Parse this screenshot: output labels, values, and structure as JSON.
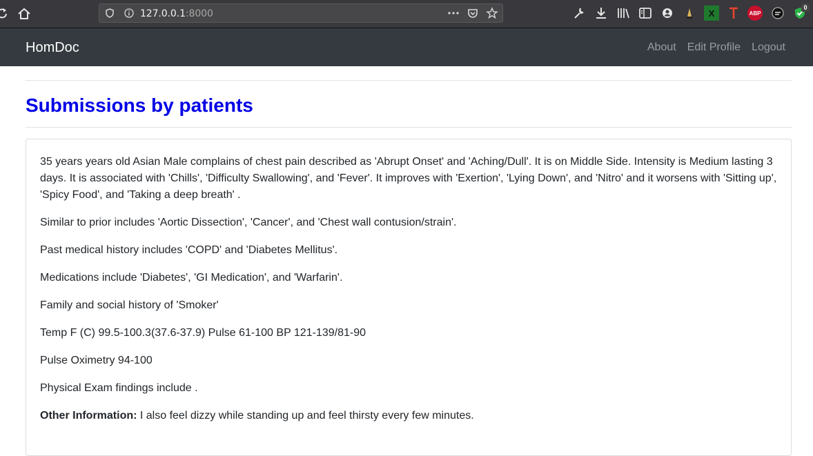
{
  "browser": {
    "url_host": "127.0.0.1",
    "url_port": ":8000"
  },
  "navbar": {
    "brand": "HomDoc",
    "links": [
      "About",
      "Edit Profile",
      "Logout"
    ]
  },
  "page": {
    "title": "Submissions by patients"
  },
  "submission": {
    "summary": "35 years years old Asian Male complains of chest pain described as 'Abrupt Onset' and 'Aching/Dull'. It is on Middle Side. Intensity is Medium lasting 3 days. It is associated with 'Chills', 'Difficulty Swallowing', and 'Fever'. It improves with 'Exertion', 'Lying Down', and 'Nitro' and it worsens with 'Sitting up', 'Spicy Food', and 'Taking a deep breath' .",
    "similar_prior": "Similar to prior includes 'Aortic Dissection', 'Cancer', and 'Chest wall contusion/strain'.",
    "past_history": "Past medical history includes 'COPD' and 'Diabetes Mellitus'.",
    "medications": "Medications include 'Diabetes', 'GI Medication', and 'Warfarin'.",
    "family_social": "Family and social history of 'Smoker'",
    "vitals": "Temp F (C) 99.5-100.3(37.6-37.9) Pulse 61-100 BP 121-139/81-90",
    "oximetry": "Pulse Oximetry 94-100",
    "exam": "Physical Exam findings include .",
    "other_label": "Other Information:",
    "other_text": " I also feel dizzy while standing up and feel thirsty every few minutes."
  },
  "extensions": {
    "notification_count": "0",
    "abp_label": "ABP"
  },
  "icons": [
    "reload-icon",
    "home-icon",
    "shield-icon",
    "info-icon",
    "more-icon",
    "pocket-icon",
    "star-icon",
    "wrench-icon",
    "download-icon",
    "library-icon",
    "sidebar-icon",
    "account-icon",
    "extension-icons"
  ]
}
